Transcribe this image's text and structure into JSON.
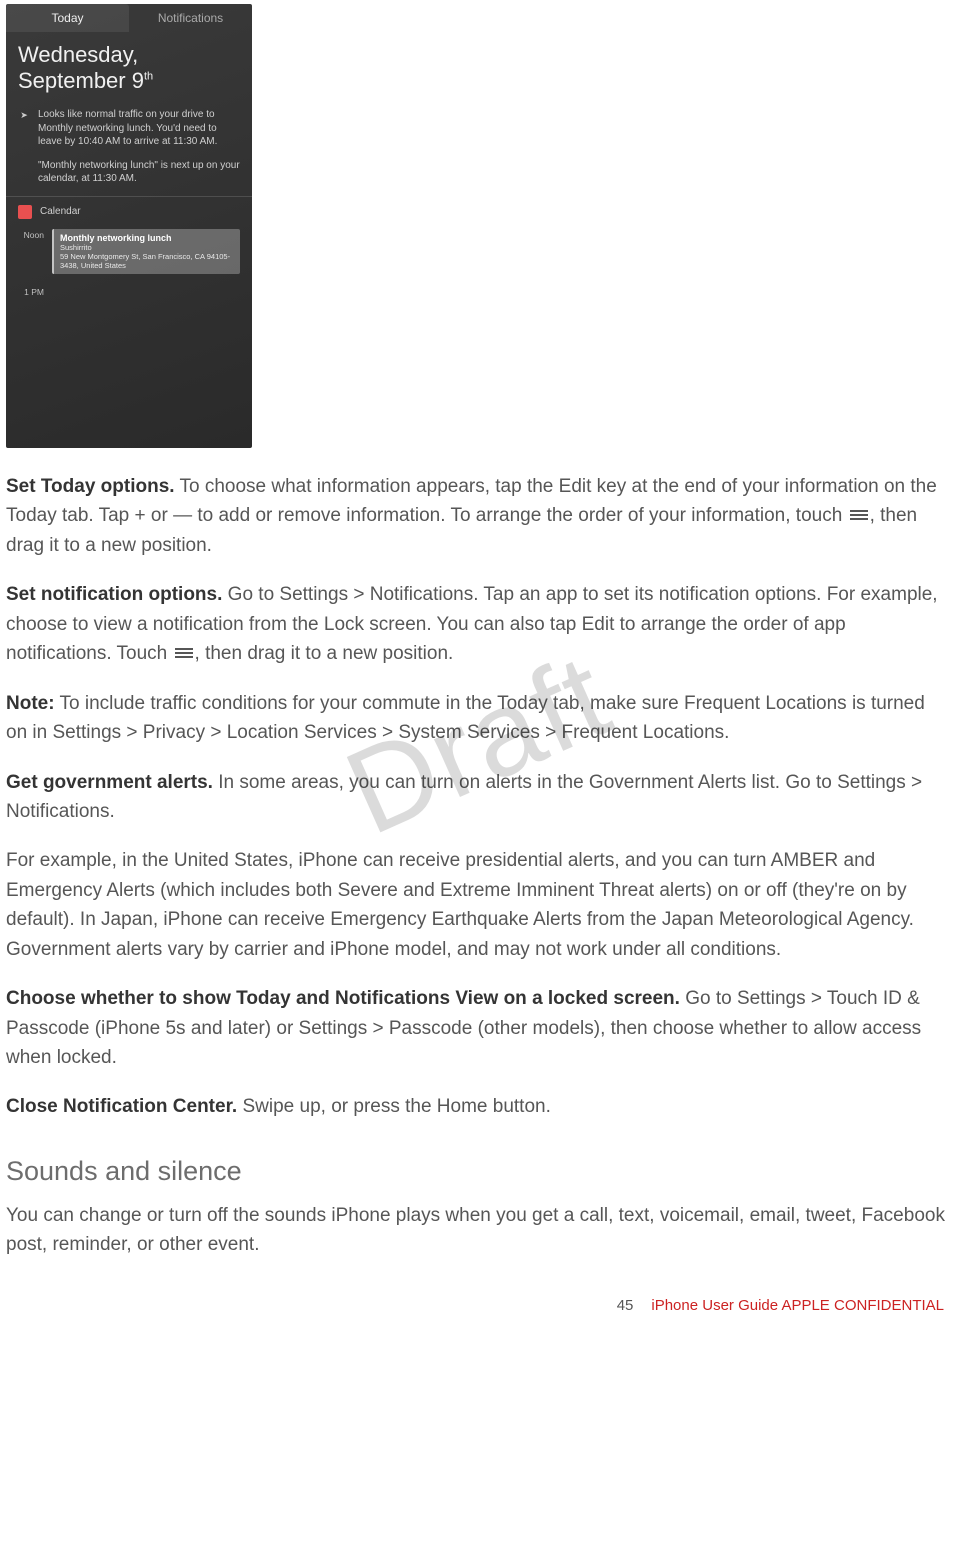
{
  "screenshot": {
    "tabs": {
      "today": "Today",
      "notifications": "Notifications"
    },
    "day": "Wednesday,",
    "date_prefix": "September 9",
    "date_suffix": "th",
    "traffic": "Looks like normal traffic on your drive to Monthly networking lunch. You'd need to leave by 10:40 AM to arrive at 11:30 AM.",
    "calendar_hint": "\"Monthly networking lunch\" is next up on your calendar, at 11:30 AM.",
    "calendar_label": "Calendar",
    "noon_label": "Noon",
    "pm_label": "1 PM",
    "event_title": "Monthly networking lunch",
    "event_sub1": "Sushirrito",
    "event_sub2": "59 New Montgomery St, San Francisco, CA 94105-3438, United States"
  },
  "p1": {
    "bold": "Set Today options.",
    "t1": " To choose what information appears, tap the Edit key at the end of your information on the Today tab. Tap + or — to add or remove information. To arrange the order of your information, touch ",
    "t2": ", then drag it to a new position."
  },
  "p2": {
    "bold": "Set notification options.",
    "t1": " Go to Settings > Notifications. Tap an app to set its notification options. For example, choose to view a notification from the Lock screen. You can also tap Edit to arrange the order of app notifications. Touch ",
    "t2": ", then drag it to a new position."
  },
  "p3": {
    "bold": "Note:",
    "t1": " To include traffic conditions for your commute in the Today tab, make sure Frequent Locations is turned on in Settings > Privacy > Location Services > System Services > Frequent Locations."
  },
  "p4": {
    "bold": "Get government alerts.",
    "t1": " In some areas, you can turn on alerts in the Government Alerts list. Go to Settings > Notifications."
  },
  "p5": {
    "t1": "For example, in the United States, iPhone can receive presidential alerts, and you can turn AMBER and Emergency Alerts (which includes both Severe and Extreme Imminent Threat alerts) on or off (they're on by default). In Japan, iPhone can receive Emergency Earthquake Alerts from the Japan Meteorological Agency. Government alerts vary by carrier and iPhone model, and may not work under all conditions."
  },
  "p6": {
    "bold": "Choose whether to show Today and Notifications View on a locked screen.",
    "t1": " Go to Settings > Touch ID & Passcode (iPhone 5s and later) or Settings > Passcode (other models), then choose whether to allow access when locked."
  },
  "p7": {
    "bold": "Close Notification Center.",
    "t1": " Swipe up, or press the Home button."
  },
  "section": "Sounds and silence",
  "p8": {
    "t1": "You can change or turn off the sounds iPhone plays when you get a call, text, voicemail, email, tweet, Facebook post, reminder, or other event."
  },
  "watermark": "Draft",
  "footer": {
    "page": "45",
    "text": "iPhone User Guide  APPLE CONFIDENTIAL"
  }
}
